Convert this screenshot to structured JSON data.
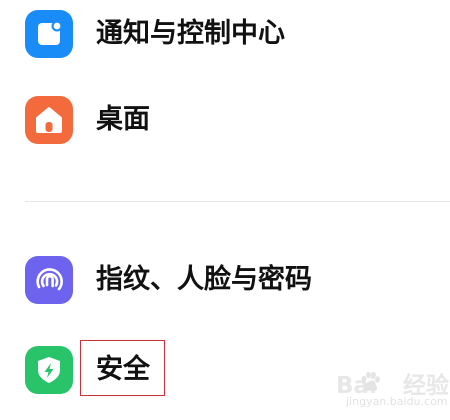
{
  "settings_list": {
    "groups": [
      {
        "items": [
          {
            "label": "通知与控制中心",
            "icon": "notification-icon",
            "icon_color": "#1a8cf7"
          },
          {
            "label": "桌面",
            "icon": "home-icon",
            "icon_color": "#f36b3c"
          }
        ]
      },
      {
        "items": [
          {
            "label": "指纹、人脸与密码",
            "icon": "fingerprint-icon",
            "icon_color": "#6e63ef"
          },
          {
            "label": "安全",
            "icon": "shield-icon",
            "icon_color": "#29c36a"
          }
        ]
      }
    ]
  },
  "highlight": {
    "color": "#c8323a",
    "target": "安全"
  },
  "watermark": {
    "brand": "Bai",
    "brand_suffix": "经验",
    "url": "jingyan.baidu.com"
  }
}
